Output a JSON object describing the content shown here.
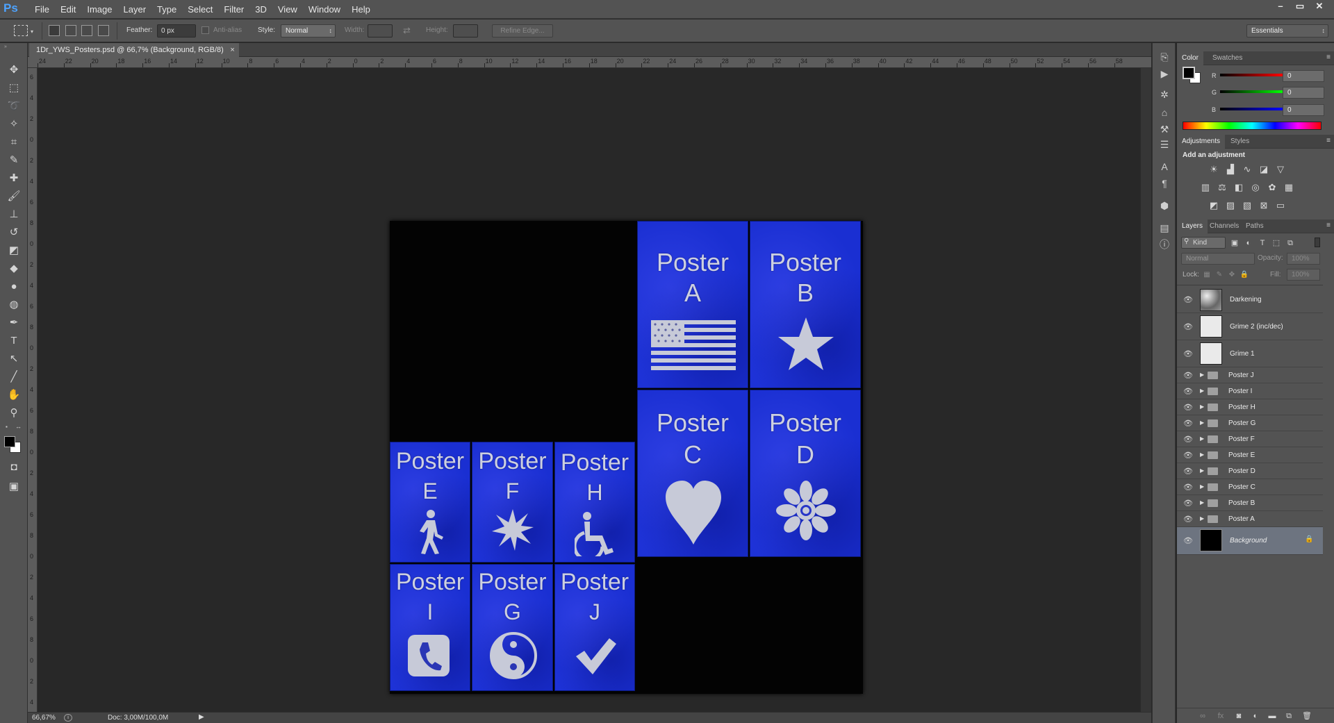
{
  "app": {
    "logo": "Ps"
  },
  "menu": [
    "File",
    "Edit",
    "Image",
    "Layer",
    "Type",
    "Select",
    "Filter",
    "3D",
    "View",
    "Window",
    "Help"
  ],
  "window_controls": {
    "minimize": "–",
    "restore": "▭",
    "close": "✕"
  },
  "options": {
    "feather_label": "Feather:",
    "feather_value": "0 px",
    "antialias_label": "Anti-alias",
    "style_label": "Style:",
    "style_value": "Normal",
    "width_label": "Width:",
    "height_label": "Height:",
    "refine_edge": "Refine Edge...",
    "workspace": "Essentials"
  },
  "document": {
    "tab_title": "1Dr_YWS_Posters.psd @ 66,7% (Background, RGB/8)",
    "tab_close": "×",
    "zoom": "66,67%",
    "doc_size": "Doc: 3,00M/100,0M"
  },
  "ruler_h": [
    "24",
    "22",
    "20",
    "18",
    "16",
    "14",
    "12",
    "10",
    "8",
    "6",
    "4",
    "2",
    "0",
    "2",
    "4",
    "6",
    "8",
    "10",
    "12",
    "14",
    "16",
    "18",
    "20",
    "22",
    "24",
    "26",
    "28",
    "30",
    "32",
    "34",
    "36",
    "38",
    "40",
    "42",
    "44",
    "46",
    "48",
    "50",
    "52",
    "54",
    "56",
    "58"
  ],
  "ruler_v": [
    "6",
    "4",
    "2",
    "0",
    "2",
    "4",
    "6",
    "8",
    "0",
    "2",
    "4",
    "6",
    "8",
    "0",
    "2",
    "4",
    "6",
    "8",
    "0",
    "2",
    "4",
    "6",
    "8",
    "0",
    "2",
    "4",
    "6",
    "8",
    "0",
    "2",
    "4"
  ],
  "posters": {
    "a": {
      "word": "Poster",
      "letter": "A",
      "icon": "flag-icon"
    },
    "b": {
      "word": "Poster",
      "letter": "B",
      "icon": "star-icon"
    },
    "c": {
      "word": "Poster",
      "letter": "C",
      "icon": "heart-icon"
    },
    "d": {
      "word": "Poster",
      "letter": "D",
      "icon": "flower-icon"
    },
    "e": {
      "word": "Poster",
      "letter": "E",
      "icon": "walking-person-icon"
    },
    "f": {
      "word": "Poster",
      "letter": "F",
      "icon": "burst-icon"
    },
    "h": {
      "word": "Poster",
      "letter": "H",
      "icon": "wheelchair-icon"
    },
    "i": {
      "word": "Poster",
      "letter": "I",
      "icon": "phone-icon"
    },
    "g": {
      "word": "Poster",
      "letter": "G",
      "icon": "yin-yang-icon"
    },
    "j": {
      "word": "Poster",
      "letter": "J",
      "icon": "checkmark-icon"
    }
  },
  "color_panel": {
    "tabs": [
      "Color",
      "Swatches"
    ],
    "r_label": "R",
    "r_value": "0",
    "g_label": "G",
    "g_value": "0",
    "b_label": "B",
    "b_value": "0"
  },
  "adjustments_panel": {
    "tabs": [
      "Adjustments",
      "Styles"
    ],
    "heading": "Add an adjustment"
  },
  "layers_panel": {
    "tabs": [
      "Layers",
      "Channels",
      "Paths"
    ],
    "filter": "Kind",
    "blend_mode": "Normal",
    "opacity_label": "Opacity:",
    "opacity_value": "100%",
    "lock_label": "Lock:",
    "fill_label": "Fill:",
    "fill_value": "100%",
    "layers": [
      {
        "name": "Darkening",
        "type": "image"
      },
      {
        "name": "Grime 2 (inc/dec)",
        "type": "image"
      },
      {
        "name": "Grime 1",
        "type": "image"
      },
      {
        "name": "Poster J",
        "type": "group"
      },
      {
        "name": "Poster I",
        "type": "group"
      },
      {
        "name": "Poster H",
        "type": "group"
      },
      {
        "name": "Poster G",
        "type": "group"
      },
      {
        "name": "Poster F",
        "type": "group"
      },
      {
        "name": "Poster E",
        "type": "group"
      },
      {
        "name": "Poster D",
        "type": "group"
      },
      {
        "name": "Poster C",
        "type": "group"
      },
      {
        "name": "Poster B",
        "type": "group"
      },
      {
        "name": "Poster A",
        "type": "group"
      },
      {
        "name": "Background",
        "type": "background"
      }
    ]
  },
  "colors": {
    "poster_blue": "#1a2fd2",
    "selection": "#6d7480",
    "panel": "#535353",
    "canvas_bg": "#282828"
  }
}
